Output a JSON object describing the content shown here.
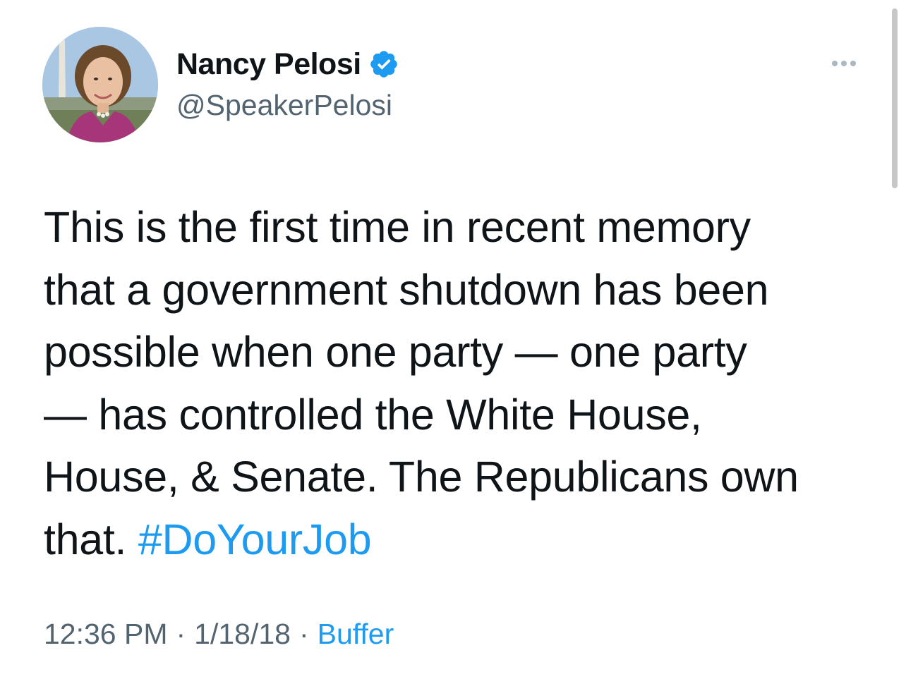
{
  "author": {
    "display_name": "Nancy Pelosi",
    "handle": "@SpeakerPelosi",
    "verified": true
  },
  "tweet": {
    "lines": [
      "This is the first time in recent memory",
      "that a government shutdown has been",
      "possible when one party — one party",
      "— has controlled the White House,",
      "House, & Senate. The Republicans own"
    ],
    "last_line_text": "that. ",
    "hashtag": "#DoYourJob"
  },
  "meta": {
    "time": "12:36 PM",
    "separator": "·",
    "date": "1/18/18",
    "source": "Buffer"
  },
  "icons": {
    "more": "more-options-icon",
    "verified": "verified-badge-icon"
  },
  "colors": {
    "link": "#1d9bf0",
    "secondary_text": "#536471",
    "primary_text": "#0f1419"
  }
}
